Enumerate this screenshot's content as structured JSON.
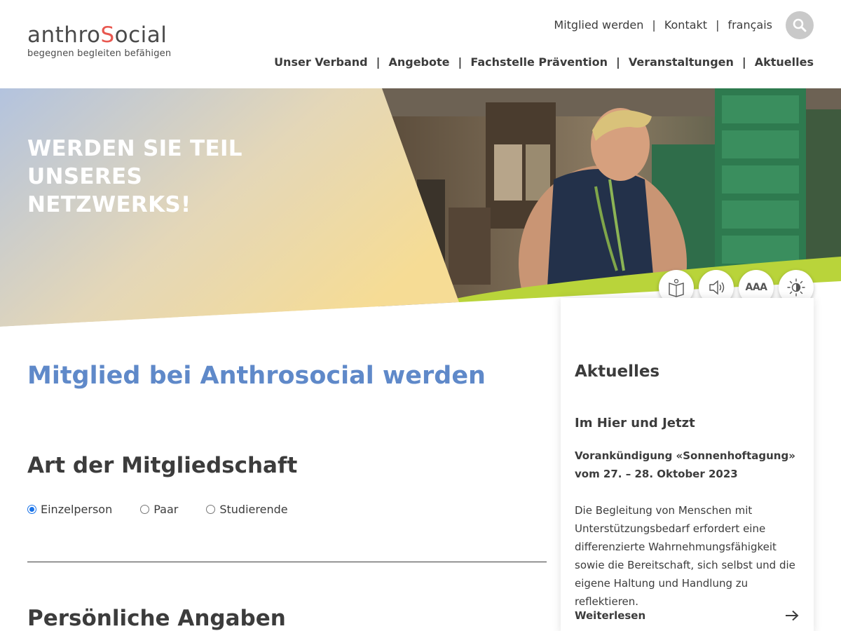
{
  "logo": {
    "word_pre": "anthro",
    "word_s": "S",
    "word_post": "ocial",
    "tagline": "begegnen begleiten befähigen"
  },
  "topnav": {
    "items": [
      "Mitglied werden",
      "Kontakt",
      "français"
    ],
    "separator": "|",
    "search_icon": "search-icon"
  },
  "mainnav": {
    "items": [
      "Unser Verband",
      "Angebote",
      "Fachstelle Prävention",
      "Veranstaltungen",
      "Aktuelles"
    ],
    "separator": "|"
  },
  "hero": {
    "title": "WERDEN SIE TEIL UNSERES NETZWERKS!"
  },
  "accessibility": {
    "buttons": [
      "easy-read-icon",
      "speaker-icon",
      "text-size-icon",
      "contrast-icon"
    ],
    "text_size_label": "AAA"
  },
  "main": {
    "page_title": "Mitglied bei Anthrosocial werden",
    "membership_heading": "Art der Mitgliedschaft",
    "membership_options": [
      {
        "label": "Einzelperson",
        "checked": true
      },
      {
        "label": "Paar",
        "checked": false
      },
      {
        "label": "Studierende",
        "checked": false
      }
    ],
    "personal_heading": "Persönliche Angaben"
  },
  "sidebar": {
    "heading": "Aktuelles",
    "subheading": "Im Hier und Jetzt",
    "lead": "Vorankündigung «Sonnenhoftagung» vom 27. – 28. Oktober 2023",
    "body": "Die Begleitung von Menschen mit Unterstützungsbedarf erfordert eine differenzierte Wahrnehmungsfähigkeit sowie die Bereitschaft, sich selbst und die eigene Haltung und Handlung zu reflektieren.",
    "link_label": "Weiterlesen",
    "link_icon": "arrow-right-icon"
  },
  "colors": {
    "brand_blue": "#5f89c9",
    "logo_accent": "#e8574f",
    "radio_checked": "#1a73e8",
    "text": "#3c3c3c"
  }
}
